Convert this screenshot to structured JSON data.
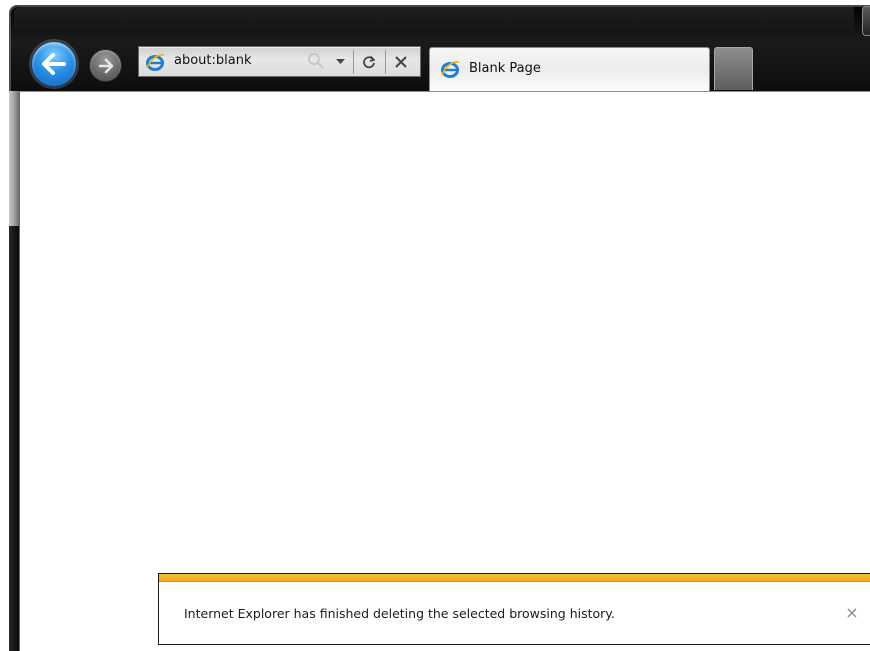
{
  "browser": {
    "address": {
      "value": "about:blank"
    },
    "tabs": [
      {
        "label": "Blank Page",
        "active": true
      }
    ],
    "icons": {
      "back": "back-arrow-icon",
      "forward": "forward-arrow-icon",
      "site": "ie-logo-icon",
      "search": "search-icon",
      "dropdown": "chevron-down-icon",
      "refresh": "refresh-icon",
      "stop": "close-icon",
      "new_tab": "new-tab-icon"
    },
    "colors": {
      "frame": "#0d0d0d",
      "back_button": "#2a93e6",
      "notification_accent": "#f2aa14"
    }
  },
  "notification": {
    "message": "Internet Explorer has finished deleting the selected browsing history.",
    "close_glyph": "×"
  }
}
